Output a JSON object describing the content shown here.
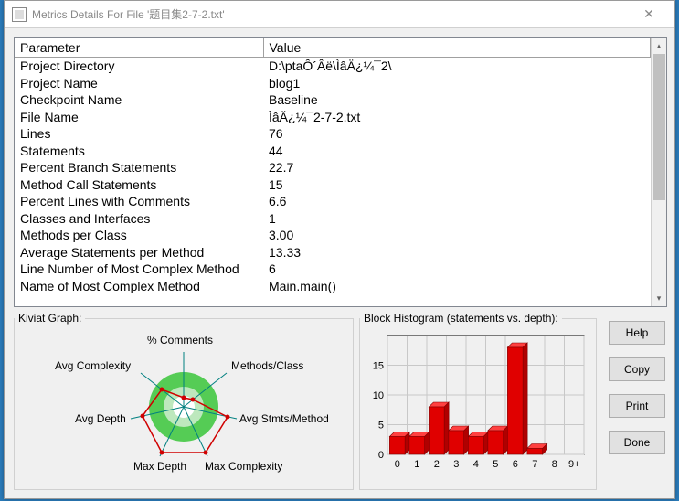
{
  "window": {
    "title": "Metrics Details For File '题目集2-7-2.txt'",
    "close_glyph": "✕"
  },
  "table": {
    "headers": {
      "param": "Parameter",
      "value": "Value"
    },
    "rows": [
      {
        "param": "Project Directory",
        "value": "D:\\ptaÔ´Âë\\ÌâÄ¿¼¯2\\"
      },
      {
        "param": "Project Name",
        "value": "blog1"
      },
      {
        "param": "Checkpoint Name",
        "value": "Baseline"
      },
      {
        "param": "File Name",
        "value": "ÌâÄ¿¼¯2-7-2.txt"
      },
      {
        "param": "Lines",
        "value": "76"
      },
      {
        "param": "Statements",
        "value": "44"
      },
      {
        "param": "Percent Branch Statements",
        "value": "22.7"
      },
      {
        "param": "Method Call Statements",
        "value": "15"
      },
      {
        "param": "Percent Lines with Comments",
        "value": "6.6"
      },
      {
        "param": "Classes and Interfaces",
        "value": "1"
      },
      {
        "param": "Methods per Class",
        "value": "3.00"
      },
      {
        "param": "Average Statements per Method",
        "value": "13.33"
      },
      {
        "param": "Line Number of Most Complex Method",
        "value": "6"
      },
      {
        "param": "Name of Most Complex Method",
        "value": "Main.main()"
      }
    ]
  },
  "kiviat": {
    "legend": "Kiviat Graph:",
    "labels": {
      "top": "% Comments",
      "tr": "Methods/Class",
      "r": "Avg Stmts/Method",
      "br": "Max Complexity",
      "bl": "Max Depth",
      "l": "Avg Depth",
      "tl": "Avg Complexity"
    }
  },
  "hist": {
    "legend": "Block Histogram (statements vs. depth):"
  },
  "chart_data": {
    "type": "bar",
    "categories": [
      "0",
      "1",
      "2",
      "3",
      "4",
      "5",
      "6",
      "7",
      "8",
      "9+"
    ],
    "values": [
      3,
      3,
      8,
      4,
      3,
      4,
      18,
      1,
      0,
      0
    ],
    "xlabel": "",
    "ylabel": "",
    "ylim": [
      0,
      20
    ],
    "yticks": [
      0,
      5,
      10,
      15
    ]
  },
  "buttons": {
    "help": "Help",
    "copy": "Copy",
    "print": "Print",
    "done": "Done"
  },
  "scroll": {
    "up_glyph": "▴",
    "down_glyph": "▾"
  }
}
